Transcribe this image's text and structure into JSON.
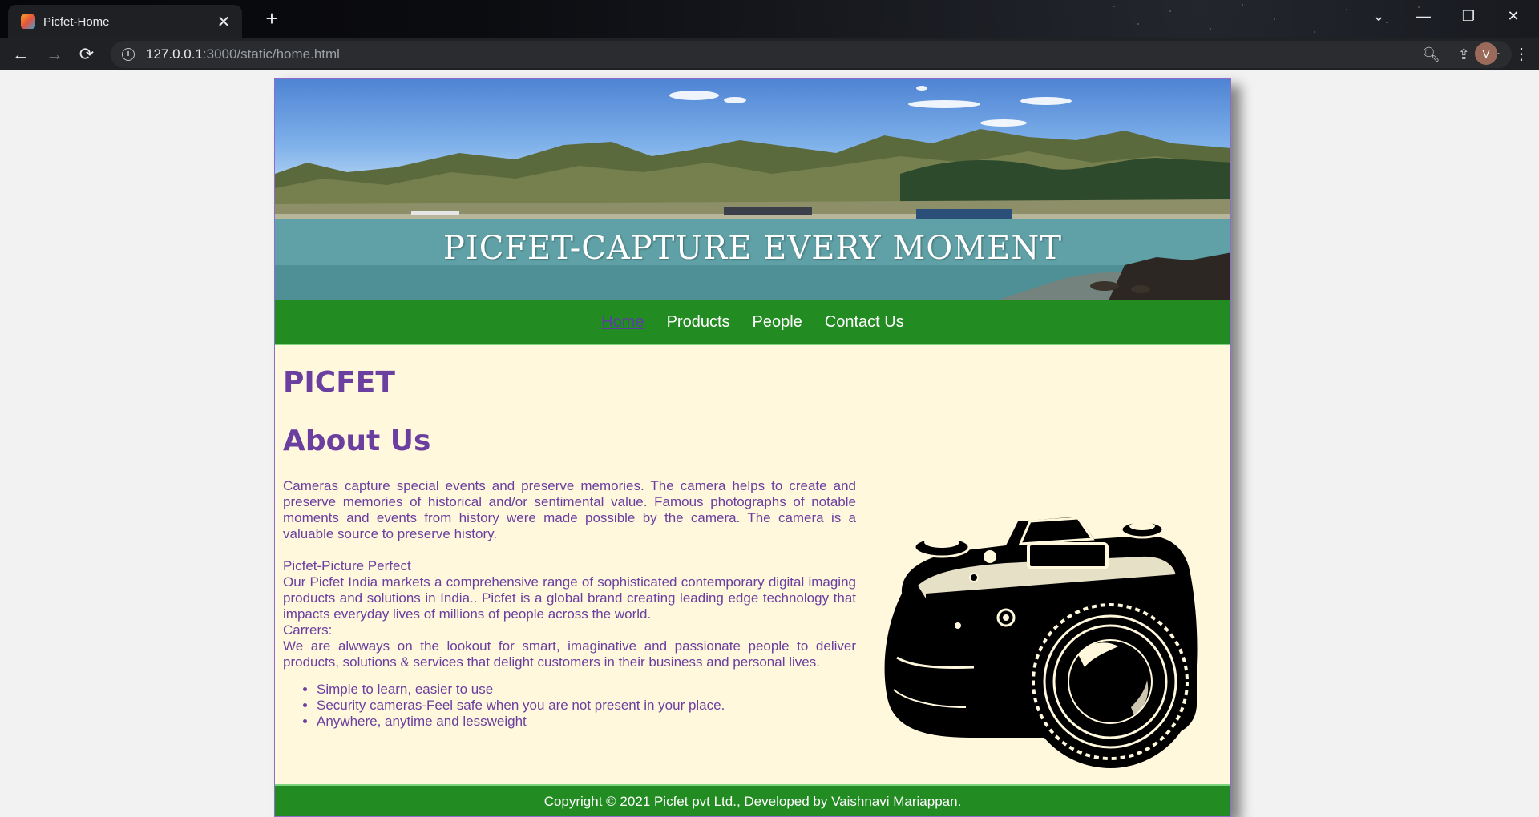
{
  "browser": {
    "tab_title": "Picfet-Home",
    "url_host": "127.0.0.1",
    "url_rest": ":3000/static/home.html",
    "profile_initial": "V"
  },
  "hero": {
    "title": "PICFET-CAPTURE EVERY MOMENT"
  },
  "nav": {
    "items": [
      "Home",
      "Products",
      "People",
      "Contact Us"
    ],
    "active": "Home"
  },
  "main": {
    "brand_heading": "PICFET",
    "about_heading": "About Us",
    "para1": "Cameras capture special events and preserve memories. The camera helps to create and preserve memories of historical and/or sentimental value. Famous photographs of notable moments and events from history were made possible by the camera. The camera is a valuable source to preserve history.",
    "tagline": "Picfet-Picture Perfect",
    "para2": "Our Picfet India markets a comprehensive range of sophisticated contemporary digital imaging products and solutions in India.. Picfet is a global brand creating leading edge technology that impacts everyday lives of millions of people across the world.",
    "careers_label": "Carrers:",
    "para3": "We are alwways on the lookout for smart, imaginative and passionate people to deliver products, solutions & services that delight customers in their business and personal lives.",
    "features": [
      "Simple to learn, easier to use",
      "Security cameras-Feel safe when you are not present in your place.",
      "Anywhere, anytime and lessweight"
    ]
  },
  "footer": {
    "text": "Copyright © 2021 Picfet pvt Ltd., Developed by Vaishnavi Mariappan."
  },
  "colors": {
    "nav_green": "#228b22",
    "text_purple": "#6a3fa0",
    "page_bg": "#fff8dc"
  }
}
